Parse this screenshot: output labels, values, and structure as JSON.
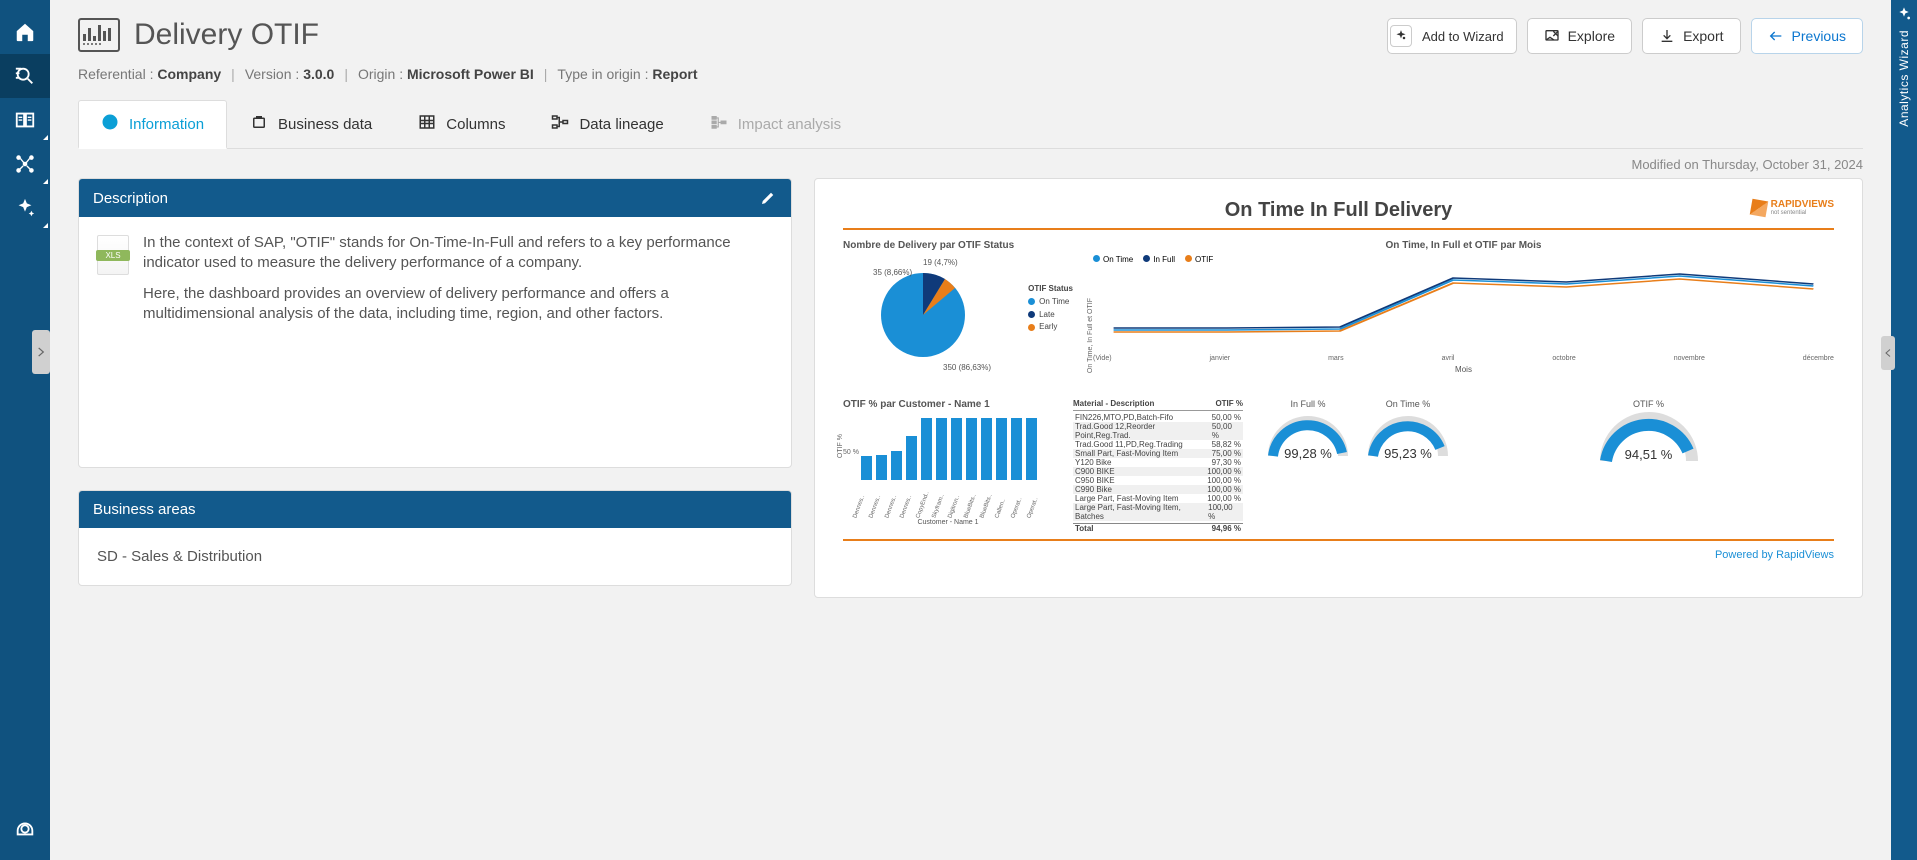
{
  "page": {
    "title": "Delivery OTIF",
    "meta": {
      "referential_label": "Referential :",
      "referential_value": "Company",
      "version_label": "Version :",
      "version_value": "3.0.0",
      "origin_label": "Origin :",
      "origin_value": "Microsoft Power BI",
      "type_label": "Type in origin :",
      "type_value": "Report"
    },
    "modified": "Modified on  Thursday, October 31, 2024"
  },
  "actions": {
    "add_wizard": "Add to Wizard",
    "explore": "Explore",
    "export": "Export",
    "previous": "Previous"
  },
  "tabs": {
    "information": "Information",
    "business_data": "Business data",
    "columns": "Columns",
    "data_lineage": "Data lineage",
    "impact": "Impact analysis"
  },
  "description": {
    "header": "Description",
    "p1": "In the context of SAP, \"OTIF\" stands for On-Time-In-Full and refers to a key performance indicator used to measure the delivery performance of a company.",
    "p2": "Here, the dashboard provides an overview of delivery performance and offers a multidimensional analysis of the data, including time, region, and other factors."
  },
  "business_areas": {
    "header": "Business areas",
    "value": "SD - Sales & Distribution"
  },
  "right_panel": {
    "label": "Analytics Wizard"
  },
  "preview": {
    "title": "On Time In Full Delivery",
    "logo": "RAPIDVIEWS",
    "logo_sub": "not sentential",
    "footer": "Powered by RapidViews",
    "pie": {
      "title": "Nombre de Delivery par OTIF Status",
      "legend_title": "OTIF Status",
      "legend": [
        "On Time",
        "Late",
        "Early"
      ],
      "label1": "35 (8,66%)",
      "label2": "19 (4,7%)",
      "label3": "350 (86,63%)"
    },
    "line": {
      "title": "On Time, In Full et OTIF par Mois",
      "legend": [
        "On Time",
        "In Full",
        "OTIF"
      ],
      "y_axis": "On Time, In Full et OTIF",
      "x_title": "Mois",
      "x": [
        "(Vide)",
        "janvier",
        "mars",
        "avril",
        "octobre",
        "novembre",
        "décembre"
      ]
    },
    "bars": {
      "title": "OTIF % par Customer - Name 1",
      "y50": "50 %",
      "y_axis": "OTIF %",
      "x_title": "Customer - Name 1",
      "x": [
        "Dennes..",
        "Dennes..",
        "Dennes..",
        "Dennes..",
        "CopyEnd..",
        "Skyfram..",
        "Digitron..",
        "BlueBits..",
        "BlueBits..",
        "Callen..",
        "Operat..",
        "Operat.."
      ]
    },
    "materials": {
      "hdr1": "Material - Description",
      "hdr2": "OTIF %",
      "rows": [
        {
          "m": "FIN226,MTO,PD,Batch-Fifo",
          "v": "50,00 %"
        },
        {
          "m": "Trad.Good 12,Reorder Point,Reg.Trad.",
          "v": "50,00 %"
        },
        {
          "m": "Trad.Good 11,PD,Reg.Trading",
          "v": "58,82 %"
        },
        {
          "m": "Small Part, Fast-Moving Item",
          "v": "75,00 %"
        },
        {
          "m": "Y120 Bike",
          "v": "97,30 %"
        },
        {
          "m": "C900 BIKE",
          "v": "100,00 %"
        },
        {
          "m": "C950 BIKE",
          "v": "100,00 %"
        },
        {
          "m": "C990 Bike",
          "v": "100,00 %"
        },
        {
          "m": "Large Part, Fast-Moving Item",
          "v": "100,00 %"
        },
        {
          "m": "Large Part, Fast-Moving Item, Batches",
          "v": "100,00 %"
        }
      ],
      "total_label": "Total",
      "total_val": "94,96 %"
    },
    "gauges": {
      "infull_title": "In Full %",
      "infull_val": "99,28 %",
      "ontime_title": "On Time %",
      "ontime_val": "95,23 %",
      "otif_title": "OTIF %",
      "otif_val": "94,51 %"
    }
  },
  "chart_data": {
    "pie": {
      "type": "pie",
      "title": "Nombre de Delivery par OTIF Status",
      "categories": [
        "On Time",
        "Late",
        "Early"
      ],
      "values": [
        350,
        35,
        19
      ],
      "percents": [
        86.63,
        8.66,
        4.7
      ],
      "colors": [
        "#1a8fd6",
        "#0f3a7a",
        "#e87e1a"
      ]
    },
    "line": {
      "type": "line",
      "title": "On Time, In Full et OTIF par Mois",
      "x": [
        "(Vide)",
        "janvier",
        "mars",
        "avril",
        "octobre",
        "novembre",
        "décembre"
      ],
      "series": [
        {
          "name": "On Time",
          "color": "#1a8fd6",
          "values": [
            0.4,
            0.4,
            0.42,
            0.95,
            0.92,
            0.98,
            0.9
          ]
        },
        {
          "name": "In Full",
          "color": "#0f3a7a",
          "values": [
            0.42,
            0.41,
            0.42,
            0.96,
            0.92,
            0.99,
            0.9
          ]
        },
        {
          "name": "OTIF",
          "color": "#e87e1a",
          "values": [
            0.38,
            0.38,
            0.4,
            0.93,
            0.9,
            0.96,
            0.88
          ]
        }
      ],
      "ylim": [
        0,
        1
      ]
    },
    "bars": {
      "type": "bar",
      "title": "OTIF % par Customer - Name 1",
      "categories": [
        "Dennes..",
        "Dennes..",
        "Dennes..",
        "Dennes..",
        "CopyEnd..",
        "Skyfram..",
        "Digitron..",
        "BlueBits..",
        "BlueBits..",
        "Callen..",
        "Operat..",
        "Operat.."
      ],
      "values": [
        40,
        42,
        48,
        70,
        100,
        100,
        100,
        100,
        100,
        100,
        100,
        100
      ],
      "ylabel": "OTIF %",
      "ylim": [
        0,
        100
      ]
    },
    "gauges": [
      {
        "name": "In Full %",
        "value": 99.28
      },
      {
        "name": "On Time %",
        "value": 95.23
      },
      {
        "name": "OTIF %",
        "value": 94.51
      }
    ]
  }
}
